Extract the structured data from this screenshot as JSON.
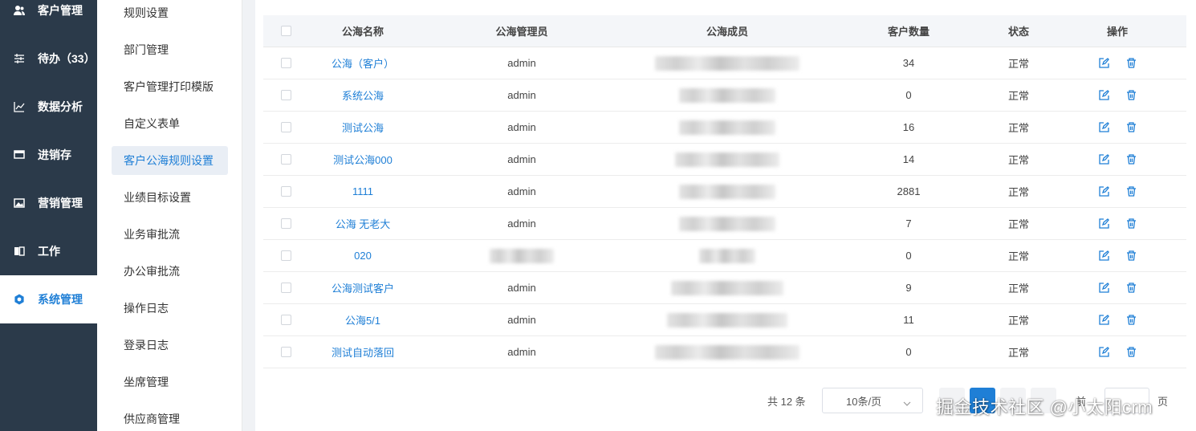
{
  "nav": {
    "items": [
      {
        "label": "客户管理",
        "icon": "user-icon"
      },
      {
        "label": "待办（33）",
        "icon": "sliders-icon"
      },
      {
        "label": "数据分析",
        "icon": "chart-icon"
      },
      {
        "label": "进销存",
        "icon": "monitor-icon"
      },
      {
        "label": "营销管理",
        "icon": "image-icon"
      },
      {
        "label": "工作",
        "icon": "book-icon"
      },
      {
        "label": "系统管理",
        "icon": "gear-icon"
      }
    ],
    "active_index": 6
  },
  "submenu": {
    "items": [
      "规则设置",
      "部门管理",
      "客户管理打印模版",
      "自定义表单",
      "客户公海规则设置",
      "业绩目标设置",
      "业务审批流",
      "办公审批流",
      "操作日志",
      "登录日志",
      "坐席管理",
      "供应商管理"
    ],
    "active_index": 4
  },
  "table": {
    "headers": {
      "name": "公海名称",
      "admin": "公海管理员",
      "members": "公海成员",
      "count": "客户数量",
      "status": "状态",
      "ops": "操作"
    },
    "rows": [
      {
        "name": "公海（客户）",
        "admin": "admin",
        "count": "34",
        "status": "正常"
      },
      {
        "name": "系统公海",
        "admin": "admin",
        "count": "0",
        "status": "正常"
      },
      {
        "name": "测试公海",
        "admin": "admin",
        "count": "16",
        "status": "正常"
      },
      {
        "name": "测试公海000",
        "admin": "admin",
        "count": "14",
        "status": "正常"
      },
      {
        "name": "1111",
        "admin": "admin",
        "count": "2881",
        "status": "正常"
      },
      {
        "name": "公海 无老大",
        "admin": "admin",
        "count": "7",
        "status": "正常"
      },
      {
        "name": "020",
        "admin": "",
        "count": "0",
        "status": "正常"
      },
      {
        "name": "公海测试客户",
        "admin": "admin",
        "count": "9",
        "status": "正常"
      },
      {
        "name": "公海5/1",
        "admin": "admin",
        "count": "11",
        "status": "正常"
      },
      {
        "name": "测试自动落回",
        "admin": "admin",
        "count": "0",
        "status": "正常"
      }
    ]
  },
  "pagination": {
    "total_text": "共 12 条",
    "page_size_text": "10条/页",
    "prev_text": "前",
    "page_suffix": "页"
  },
  "watermark": "掘金技术社区 @小太阳crm",
  "colors": {
    "accent": "#1f7fd6",
    "nav_bg": "#2b3a4a",
    "header_bg": "#f4f6f9"
  }
}
